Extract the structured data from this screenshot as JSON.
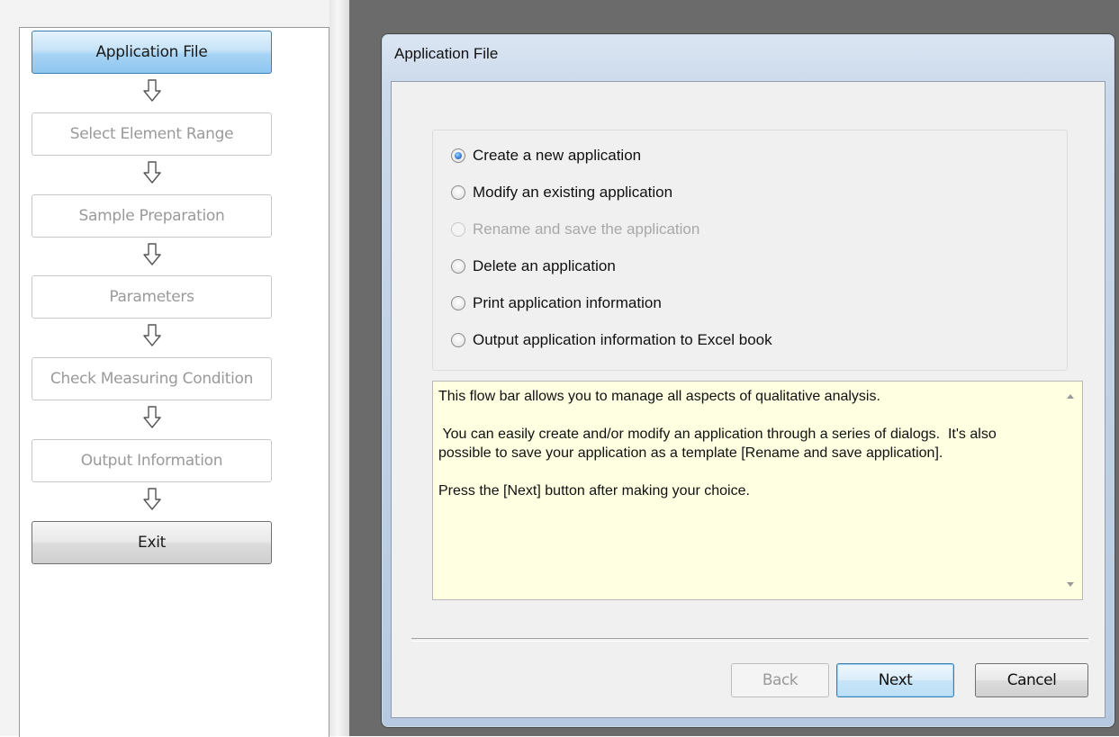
{
  "flow_bar": {
    "steps": [
      {
        "label": "Application File",
        "state": "active"
      },
      {
        "label": "Select Element Range",
        "state": "disabled"
      },
      {
        "label": "Sample Preparation",
        "state": "disabled"
      },
      {
        "label": "Parameters",
        "state": "disabled"
      },
      {
        "label": "Check Measuring Condition",
        "state": "disabled"
      },
      {
        "label": "Output Information",
        "state": "disabled"
      },
      {
        "label": "Exit",
        "state": "normal"
      }
    ],
    "arrow_icon": "down-arrow-icon"
  },
  "dialog": {
    "title": "Application File",
    "options": [
      {
        "label": "Create a new application",
        "checked": true,
        "enabled": true
      },
      {
        "label": "Modify an existing application",
        "checked": false,
        "enabled": true
      },
      {
        "label": "Rename and save the application",
        "checked": false,
        "enabled": false
      },
      {
        "label": "Delete an application",
        "checked": false,
        "enabled": true
      },
      {
        "label": "Print application information",
        "checked": false,
        "enabled": true
      },
      {
        "label": "Output application information to Excel book",
        "checked": false,
        "enabled": true
      }
    ],
    "info_text": "This flow bar allows you to manage all aspects of qualitative analysis.\n\n You can easily create and/or modify an application through a series of dialogs.  It's also possible to save your application as a template [Rename and save application].\n\nPress the [Next] button after making your choice.",
    "buttons": {
      "back": "Back",
      "next": "Next",
      "cancel": "Cancel"
    }
  },
  "colors": {
    "info_background": "#ffffe1",
    "active_step": "#a7d3f4",
    "dialog_frame": "#c6d5e8"
  }
}
